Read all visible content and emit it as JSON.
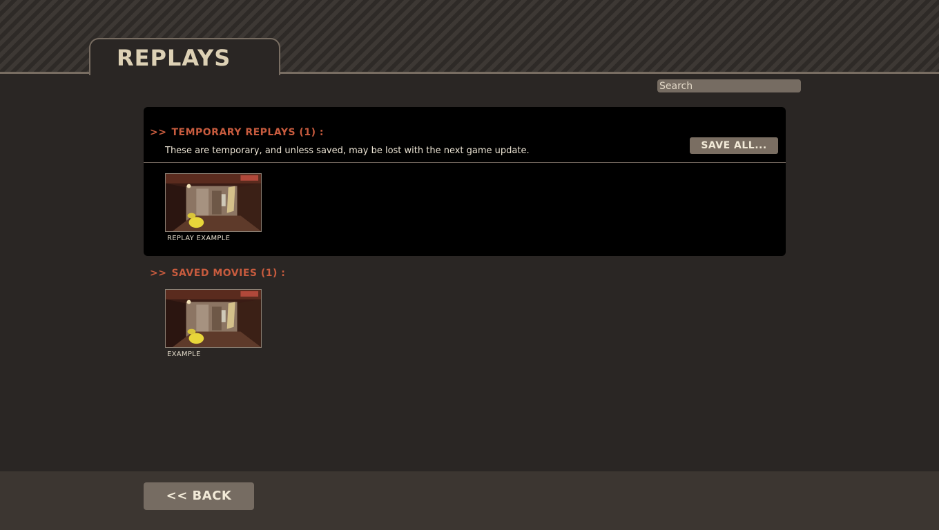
{
  "header": {
    "title": "REPLAYS"
  },
  "search": {
    "placeholder": "Search",
    "value": ""
  },
  "temporary": {
    "chevron": ">>",
    "title": "TEMPORARY REPLAYS (1) :",
    "description": "These are temporary, and unless saved, may be lost with the next game update.",
    "save_all_label": "SAVE ALL...",
    "items": [
      {
        "label": "REPLAY EXAMPLE",
        "thumbnail": "replay-screenshot"
      }
    ]
  },
  "saved": {
    "chevron": ">>",
    "title": "SAVED MOVIES (1) :",
    "items": [
      {
        "label": "EXAMPLE",
        "thumbnail": "movie-screenshot"
      }
    ]
  },
  "footer": {
    "back_label": "<< BACK"
  },
  "colors": {
    "background": "#2a2624",
    "panel": "#000000",
    "accent_red": "#c75b3e",
    "button": "#766c62",
    "title_text": "#ddd1b5",
    "footer": "#3c3631"
  }
}
